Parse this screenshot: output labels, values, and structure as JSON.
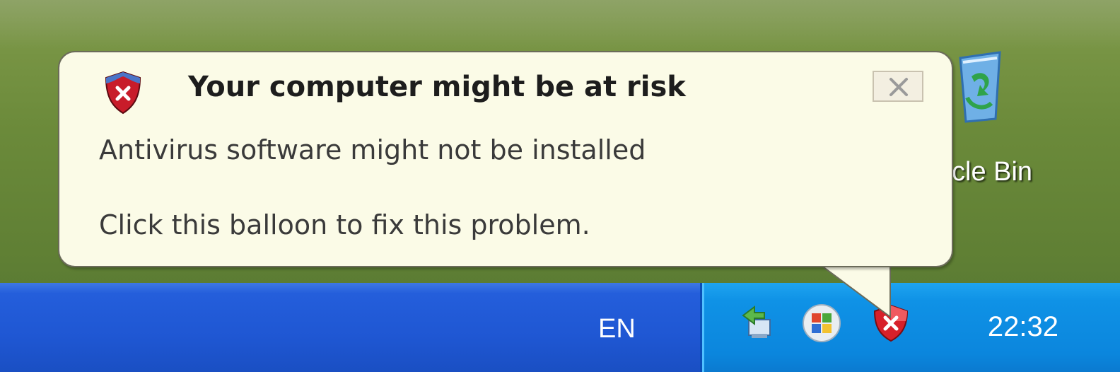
{
  "desktop": {
    "recycle_bin": {
      "label": "cle Bin",
      "icon": "recycle-bin-icon"
    }
  },
  "balloon": {
    "title": "Your computer might be at risk",
    "line1": "Antivirus software might not be installed",
    "line2": "Click this balloon to fix this problem.",
    "icon": "security-shield-warning-icon",
    "close_icon": "close-icon"
  },
  "taskbar": {
    "language": "EN",
    "clock": "22:32",
    "tray_icons": [
      "network-icon",
      "windows-update-icon",
      "security-center-icon"
    ],
    "colors": {
      "taskbar": "#245edb",
      "tray": "#0f92e6",
      "balloon_background": "#fbfbe7"
    }
  }
}
